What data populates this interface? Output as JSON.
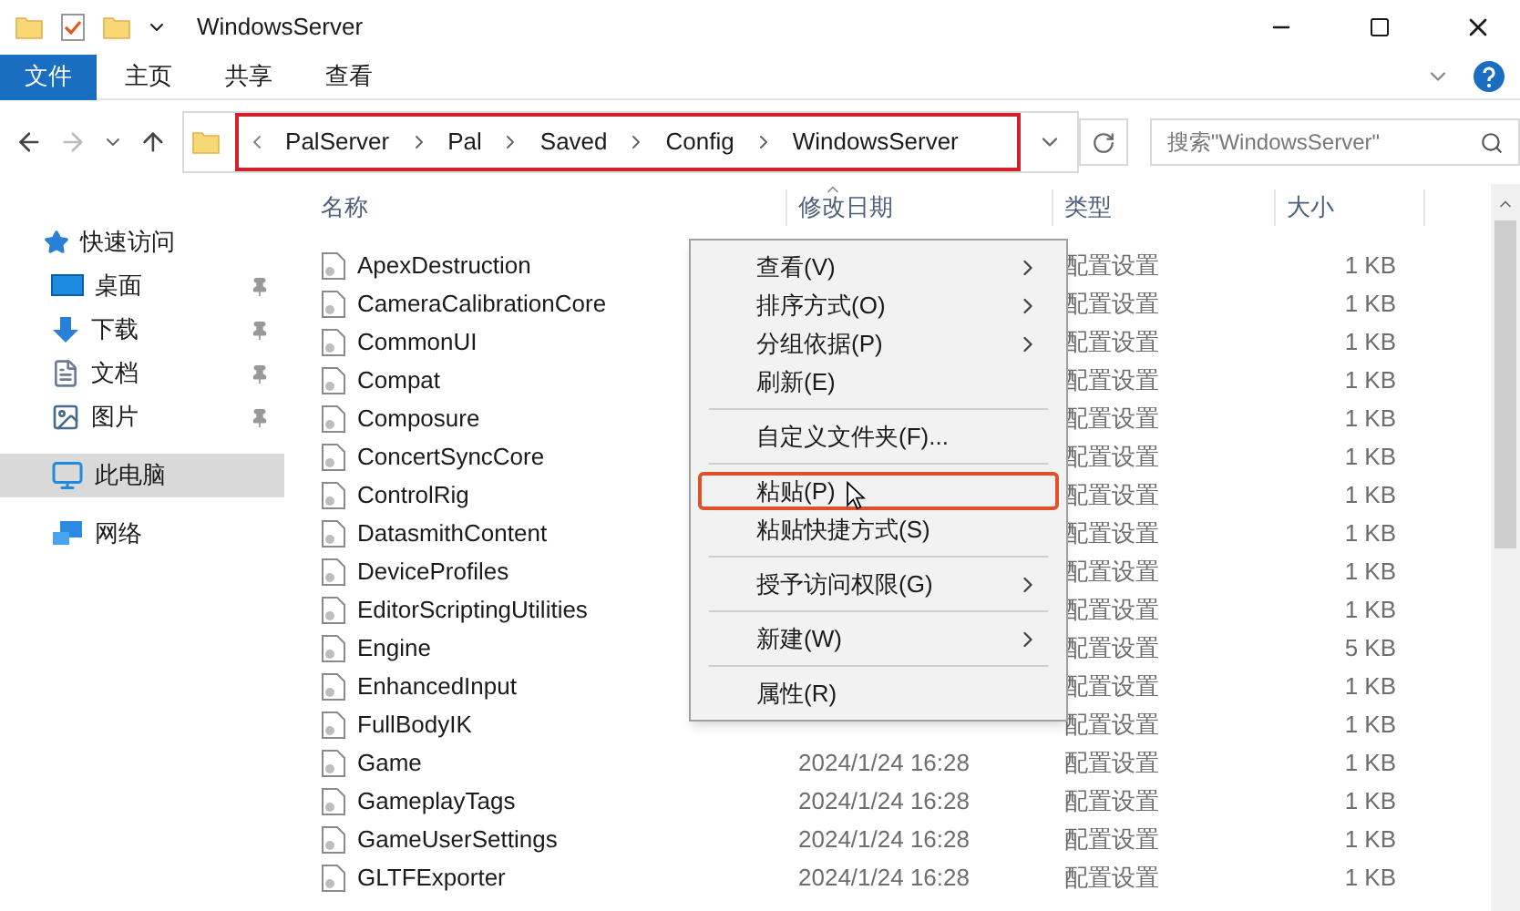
{
  "window": {
    "title": "WindowsServer"
  },
  "ribbon_tabs": [
    {
      "label": "文件",
      "kind": "file",
      "selected": false
    },
    {
      "label": "主页",
      "kind": "tab",
      "selected": false
    },
    {
      "label": "共享",
      "kind": "tab",
      "selected": false
    },
    {
      "label": "查看",
      "kind": "tab",
      "selected": false
    }
  ],
  "address_bar": {
    "highlighted": true,
    "path": [
      "PalServer",
      "Pal",
      "Saved",
      "Config",
      "WindowsServer"
    ]
  },
  "search": {
    "placeholder": "搜索\"WindowsServer\""
  },
  "sidebar": {
    "items": [
      {
        "label": "快速访问",
        "kind": "star",
        "pinned": false,
        "selected": false
      },
      {
        "label": "桌面",
        "kind": "desktop",
        "pinned": true,
        "selected": false
      },
      {
        "label": "下载",
        "kind": "download",
        "pinned": true,
        "selected": false
      },
      {
        "label": "文档",
        "kind": "document",
        "pinned": true,
        "selected": false
      },
      {
        "label": "图片",
        "kind": "pictures",
        "pinned": true,
        "selected": false
      },
      {
        "label": "此电脑",
        "kind": "computer",
        "pinned": false,
        "selected": true
      },
      {
        "label": "网络",
        "kind": "network",
        "pinned": false,
        "selected": false
      }
    ]
  },
  "table": {
    "columns": [
      "名称",
      "修改日期",
      "类型",
      "大小"
    ],
    "rows": [
      {
        "name": "ApexDestruction",
        "type": "配置设置",
        "size": "1 KB"
      },
      {
        "name": "CameraCalibrationCore",
        "type": "配置设置",
        "size": "1 KB"
      },
      {
        "name": "CommonUI",
        "type": "配置设置",
        "size": "1 KB"
      },
      {
        "name": "Compat",
        "type": "配置设置",
        "size": "1 KB"
      },
      {
        "name": "Composure",
        "type": "配置设置",
        "size": "1 KB"
      },
      {
        "name": "ConcertSyncCore",
        "type": "配置设置",
        "size": "1 KB"
      },
      {
        "name": "ControlRig",
        "type": "配置设置",
        "size": "1 KB"
      },
      {
        "name": "DatasmithContent",
        "type": "配置设置",
        "size": "1 KB"
      },
      {
        "name": "DeviceProfiles",
        "type": "配置设置",
        "size": "1 KB"
      },
      {
        "name": "EditorScriptingUtilities",
        "type": "配置设置",
        "size": "1 KB"
      },
      {
        "name": "Engine",
        "type": "配置设置",
        "size": "5 KB"
      },
      {
        "name": "EnhancedInput",
        "type": "配置设置",
        "size": "1 KB"
      },
      {
        "name": "FullBodyIK",
        "type": "配置设置",
        "size": "1 KB"
      },
      {
        "name": "Game",
        "date": "2024/1/24 16:28",
        "type": "配置设置",
        "size": "1 KB"
      },
      {
        "name": "GameplayTags",
        "date": "2024/1/24 16:28",
        "type": "配置设置",
        "size": "1 KB"
      },
      {
        "name": "GameUserSettings",
        "date": "2024/1/24 16:28",
        "type": "配置设置",
        "size": "1 KB"
      },
      {
        "name": "GLTFExporter",
        "date": "2024/1/24 16:28",
        "type": "配置设置",
        "size": "1 KB"
      }
    ]
  },
  "context_menu": {
    "items": [
      {
        "kind": "item",
        "label": "查看(V)",
        "submenu": true,
        "highlighted": false
      },
      {
        "kind": "item",
        "label": "排序方式(O)",
        "submenu": true,
        "highlighted": false
      },
      {
        "kind": "item",
        "label": "分组依据(P)",
        "submenu": true,
        "highlighted": false
      },
      {
        "kind": "item",
        "label": "刷新(E)",
        "submenu": false,
        "highlighted": false
      },
      {
        "kind": "separator"
      },
      {
        "kind": "item",
        "label": "自定义文件夹(F)...",
        "submenu": false,
        "highlighted": false
      },
      {
        "kind": "separator"
      },
      {
        "kind": "item",
        "label": "粘贴(P)",
        "submenu": false,
        "highlighted": true
      },
      {
        "kind": "item",
        "label": "粘贴快捷方式(S)",
        "submenu": false,
        "highlighted": false
      },
      {
        "kind": "separator"
      },
      {
        "kind": "item",
        "label": "授予访问权限(G)",
        "submenu": true,
        "highlighted": false
      },
      {
        "kind": "separator"
      },
      {
        "kind": "item",
        "label": "新建(W)",
        "submenu": true,
        "highlighted": false
      },
      {
        "kind": "separator"
      },
      {
        "kind": "item",
        "label": "属性(R)",
        "submenu": false,
        "highlighted": false
      }
    ]
  }
}
